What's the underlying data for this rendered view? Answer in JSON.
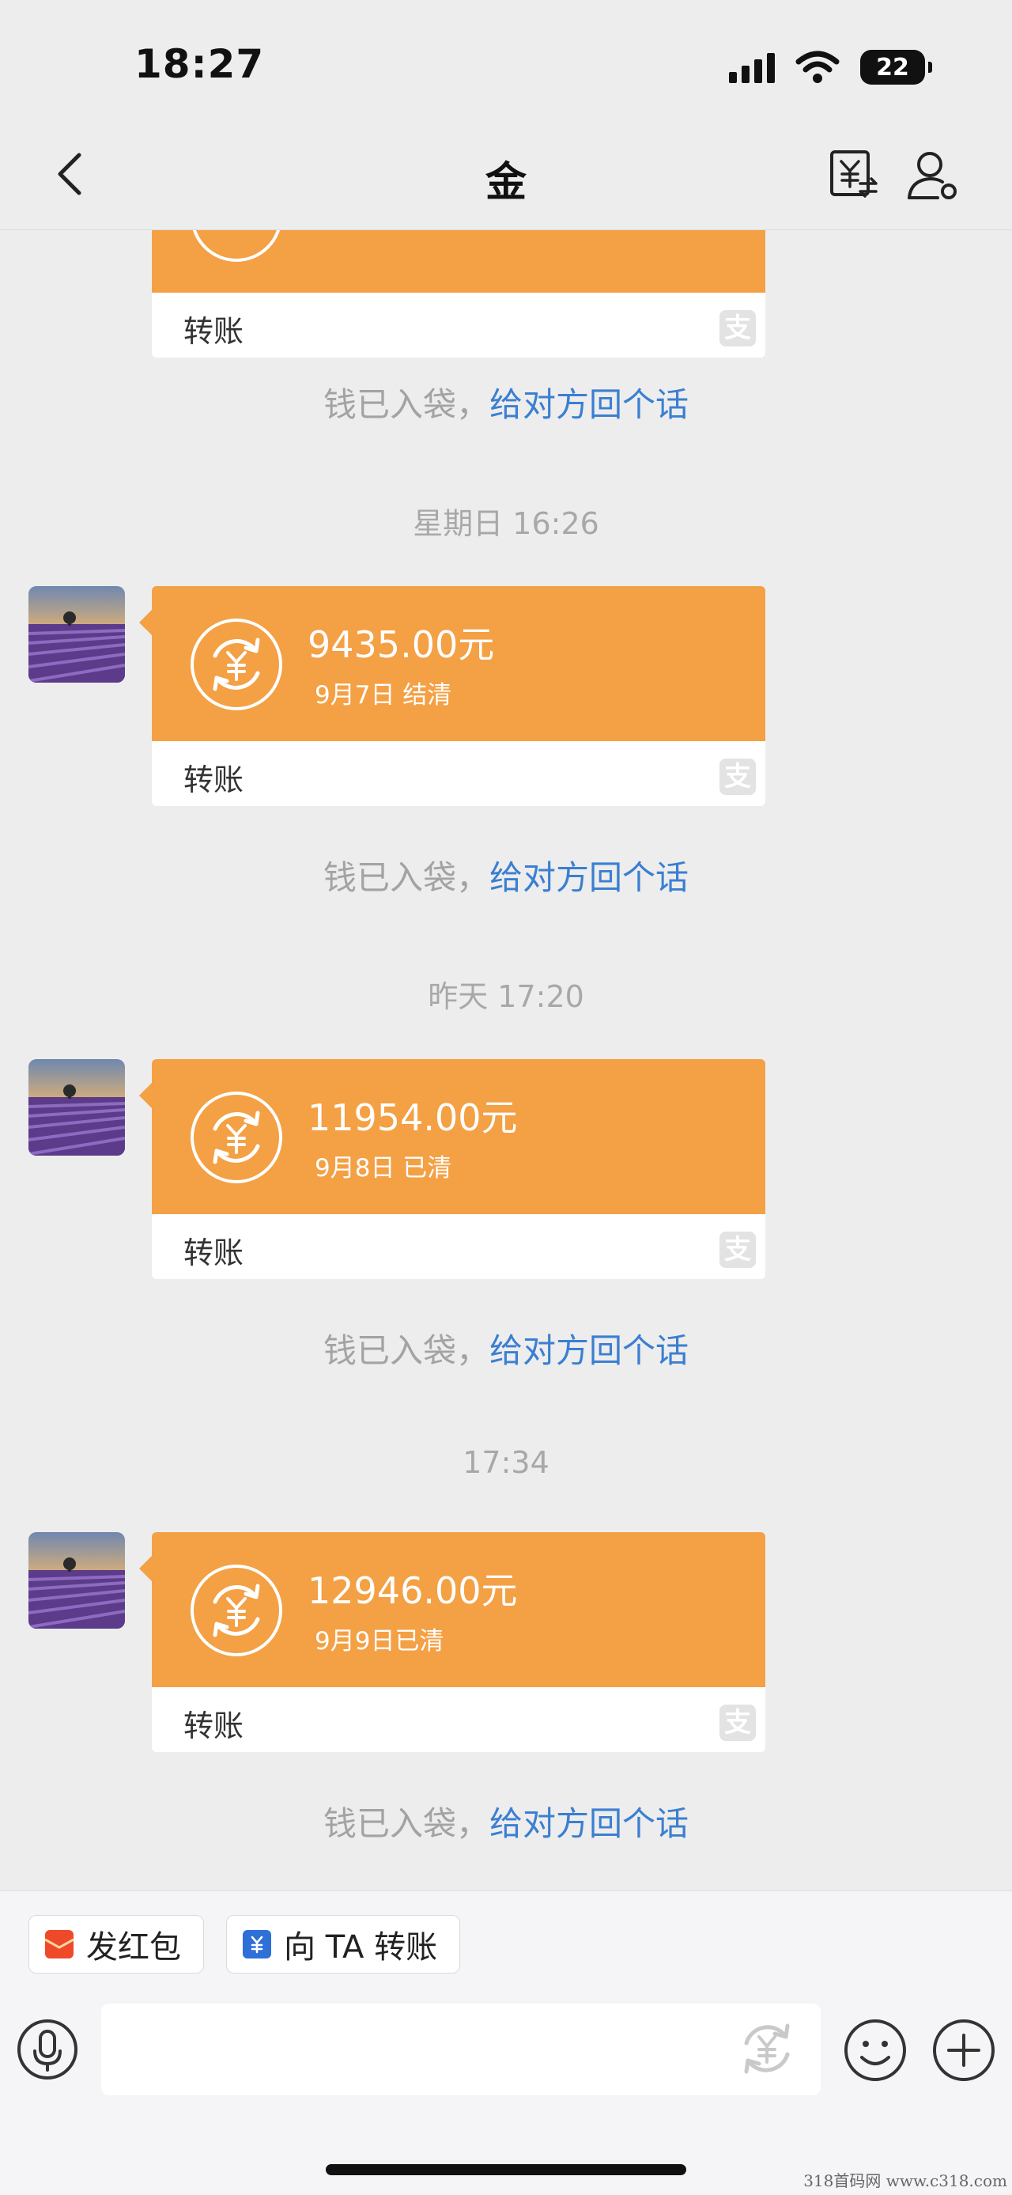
{
  "status": {
    "time": "18:27",
    "battery": "22"
  },
  "nav": {
    "title": "金"
  },
  "messages": [
    {
      "label": "转账",
      "pay_icon": "支"
    },
    {
      "amount": "9435.00元",
      "note": "9月7日 结清",
      "label": "转账",
      "pay_icon": "支"
    },
    {
      "amount": "11954.00元",
      "note": "9月8日 已清",
      "label": "转账",
      "pay_icon": "支"
    },
    {
      "amount": "12946.00元",
      "note": "9月9日已清",
      "label": "转账",
      "pay_icon": "支"
    }
  ],
  "hints": {
    "prefix": "钱已入袋，",
    "link": "给对方回个话"
  },
  "time_separators": [
    "星期日 16:26",
    "昨天 17:20",
    "17:34"
  ],
  "quick_actions": {
    "red_packet": "发红包",
    "transfer": "向 TA 转账"
  },
  "input": {
    "placeholder": ""
  },
  "watermark": "318首码网  www.c318.com",
  "colors": {
    "bubble": "#f4a044",
    "link": "#3b7fd1",
    "red_packet": "#ee4a2a",
    "transfer_icon": "#2e6fd8"
  },
  "icons": [
    "back-arrow-icon",
    "transfer-yuan-icon",
    "profile-icon",
    "yuan-coin-icon",
    "alipay-icon",
    "microphone-icon",
    "emoji-icon",
    "plus-icon"
  ]
}
